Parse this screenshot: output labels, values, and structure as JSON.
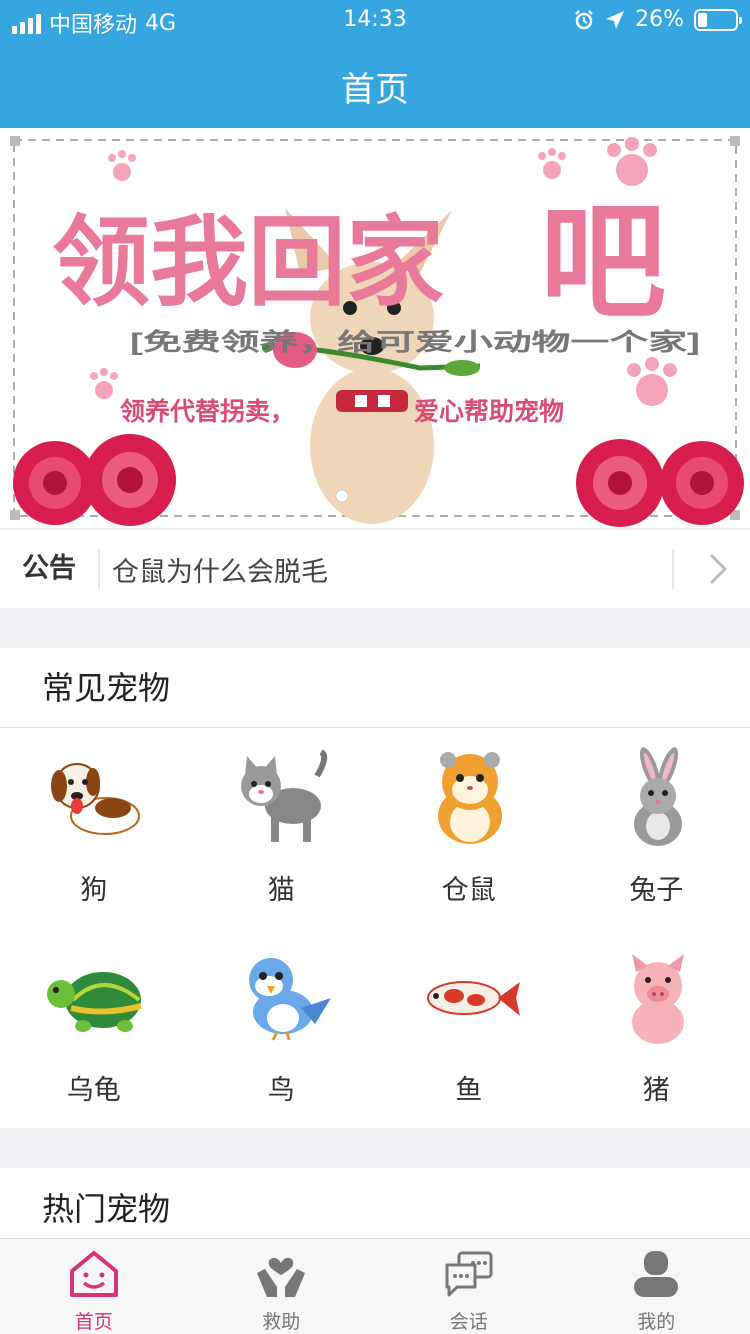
{
  "status_bar": {
    "carrier": "中国移动",
    "network": "4G",
    "time": "14:33",
    "battery": "26%",
    "battery_level": 0.26
  },
  "header": {
    "title": "首页"
  },
  "banner": {
    "headline_part1": "领我回家",
    "headline_part2": "吧",
    "subtitle": "[免费领养，给可爱小动物一个家]",
    "slogan_left": "领养代替拐卖，",
    "slogan_right": "爱心帮助宠物"
  },
  "notice": {
    "tag": "公告",
    "text": "仓鼠为什么会脱毛"
  },
  "common_pets": {
    "title": "常见宠物",
    "items": [
      {
        "name": "狗",
        "icon": "dog-icon"
      },
      {
        "name": "猫",
        "icon": "cat-icon"
      },
      {
        "name": "仓鼠",
        "icon": "hamster-icon"
      },
      {
        "name": "兔子",
        "icon": "rabbit-icon"
      },
      {
        "name": "乌龟",
        "icon": "turtle-icon"
      },
      {
        "name": "鸟",
        "icon": "bird-icon"
      },
      {
        "name": "鱼",
        "icon": "fish-icon"
      },
      {
        "name": "猪",
        "icon": "pig-icon"
      }
    ]
  },
  "hot_pets": {
    "title": "热门宠物"
  },
  "tabbar": {
    "items": [
      {
        "label": "首页",
        "icon": "home-icon",
        "active": true
      },
      {
        "label": "救助",
        "icon": "rescue-icon",
        "active": false
      },
      {
        "label": "会话",
        "icon": "chat-icon",
        "active": false
      },
      {
        "label": "我的",
        "icon": "user-icon",
        "active": false
      }
    ],
    "active_color": "#d6337a"
  },
  "colors": {
    "header": "#35a6e0",
    "banner_pink": "#e8799a"
  }
}
